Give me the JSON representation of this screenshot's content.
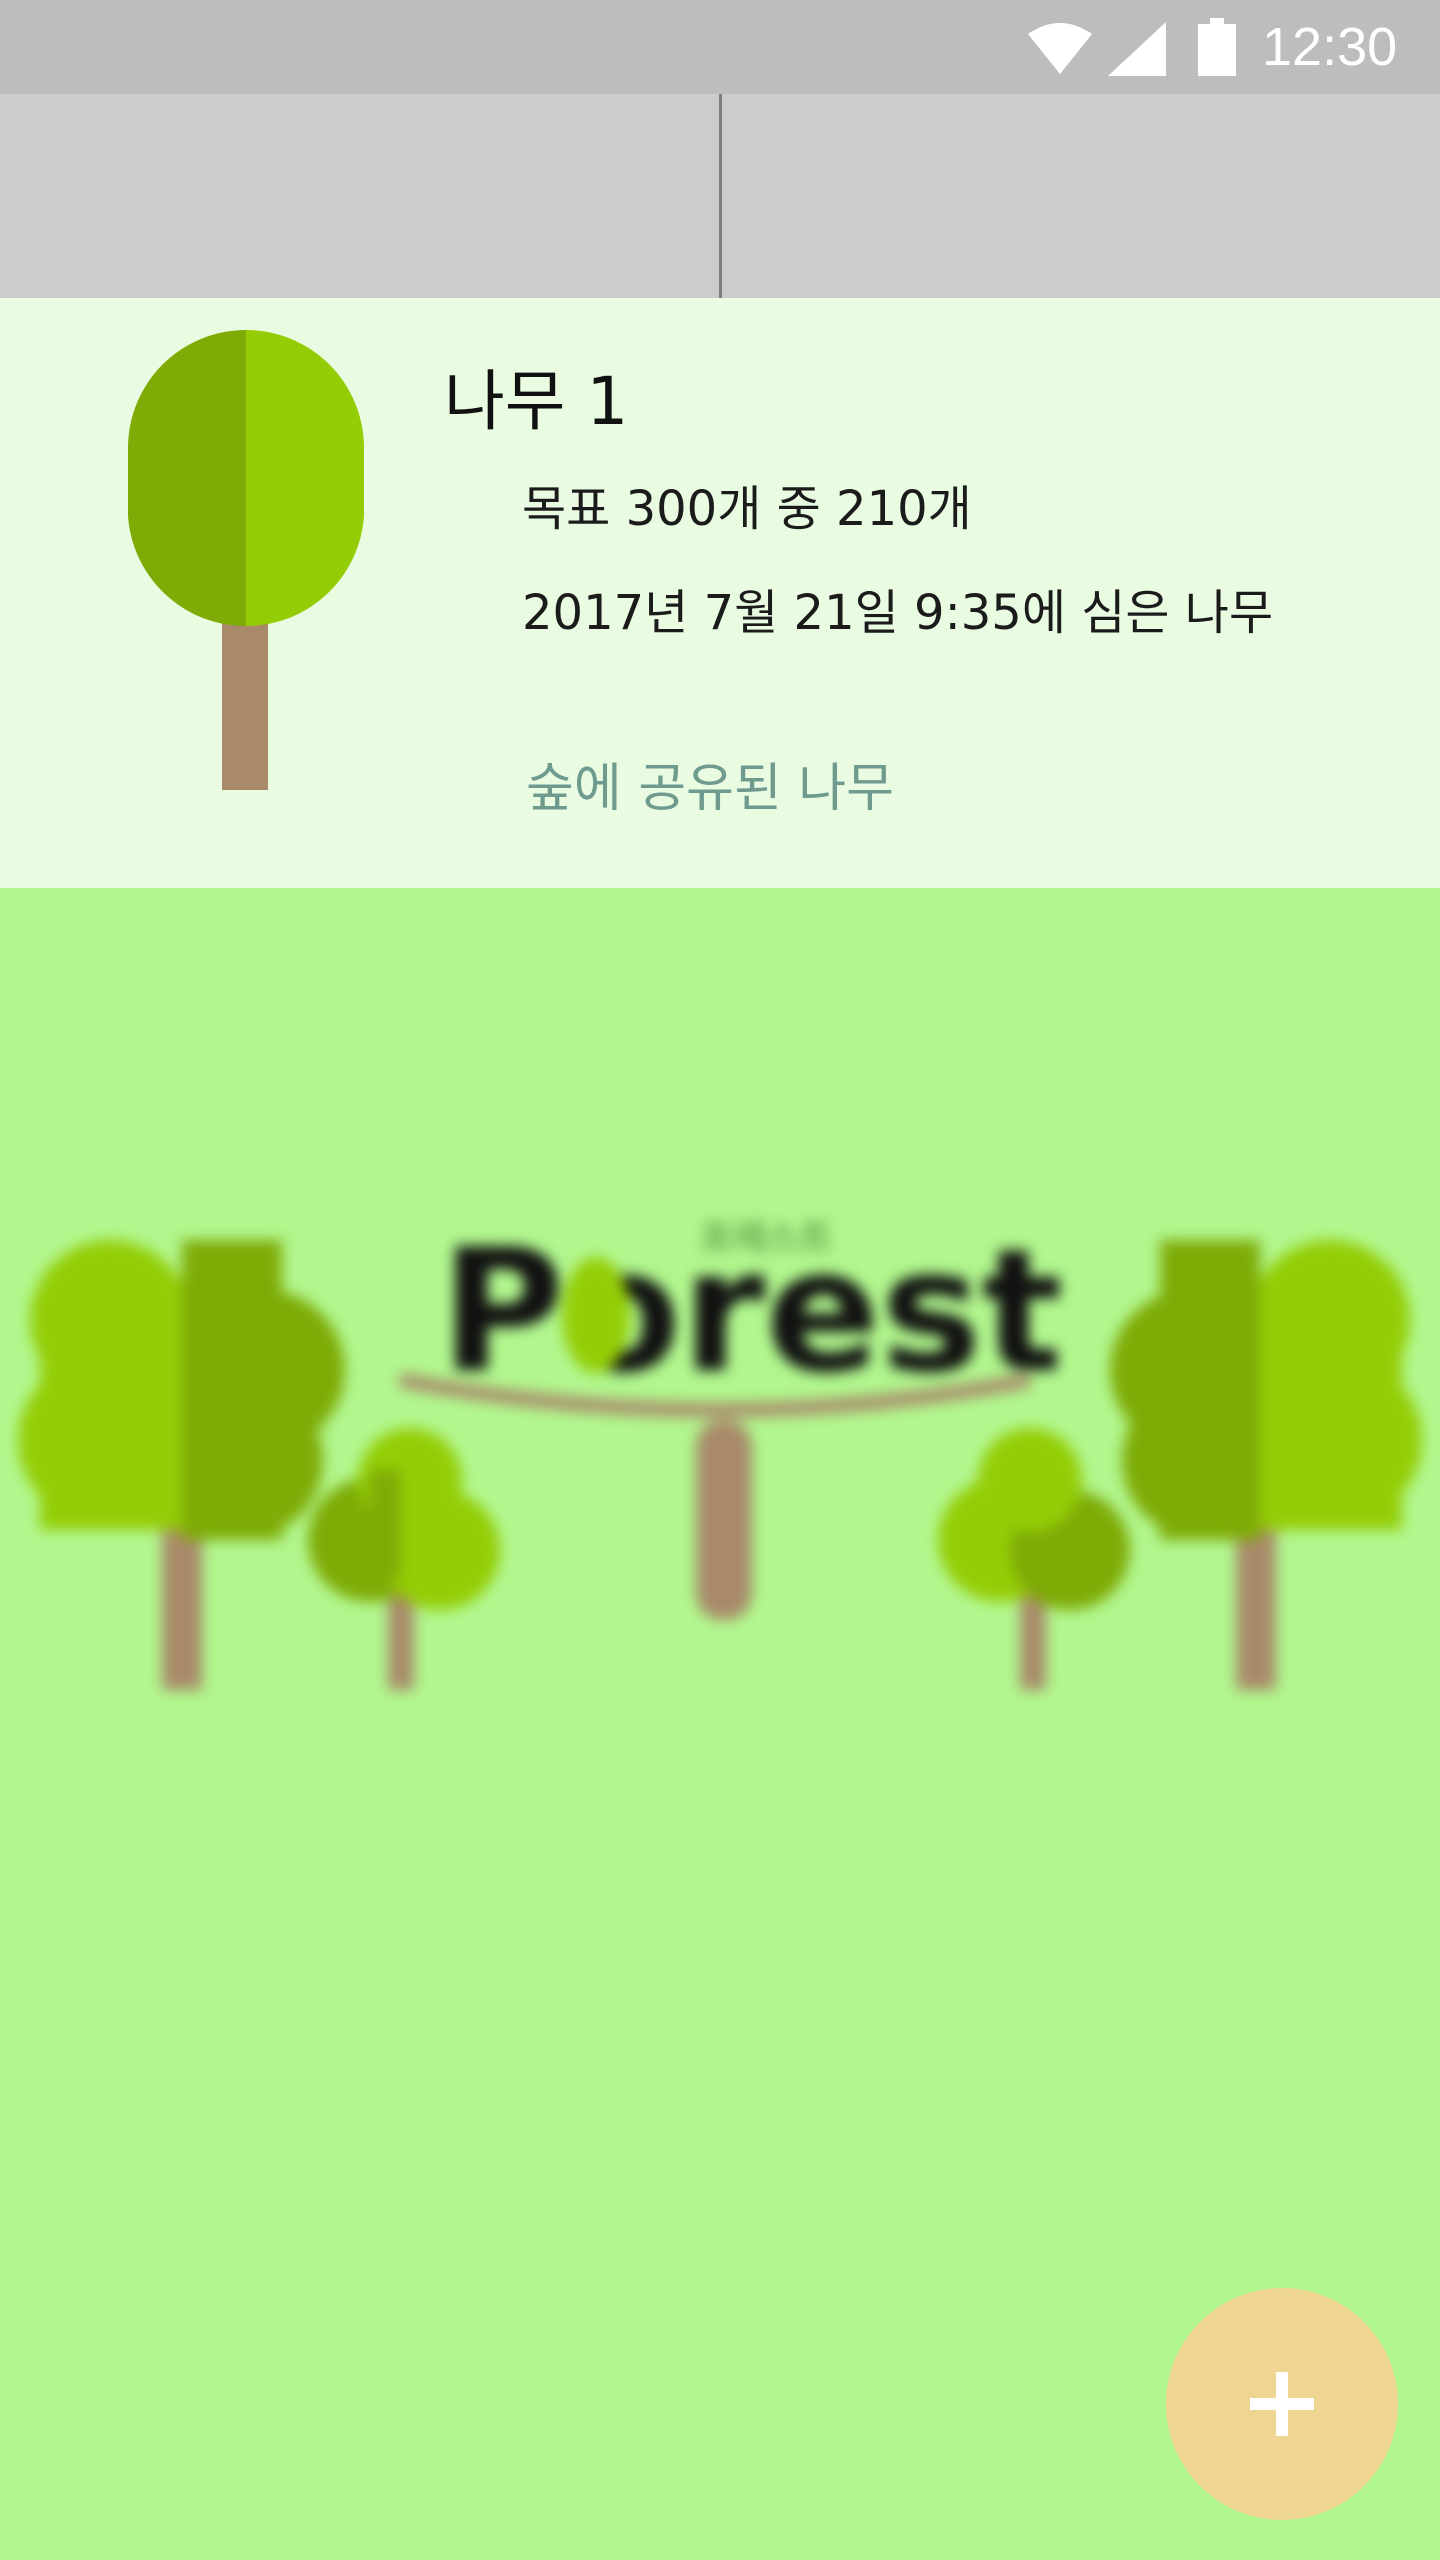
{
  "status_bar": {
    "time": "12:30",
    "icons": [
      "wifi-icon",
      "cell-signal-icon",
      "battery-icon"
    ]
  },
  "tabs": [
    "",
    ""
  ],
  "tree_card": {
    "title": "나무 1",
    "goal_text": "목표 300개 중 210개",
    "planted_text": "2017년 7월 21일 9:35에 심은 나무",
    "shared_label": "숲에 공유된 나무",
    "icon": "tree-icon"
  },
  "forest_logo": {
    "text": "Porest",
    "subtitle": "포레스트"
  },
  "fab": {
    "icon": "plus-icon"
  },
  "colors": {
    "status_bar": "#bdbdbd",
    "tab_bar": "#cccccc",
    "card_bg": "#e9fce2",
    "page_bg": "#b2f78e",
    "shared_label": "#6f9a8e",
    "fab": "#efd592",
    "leaf_dark": "#7eab06",
    "leaf_light": "#94cd06",
    "trunk": "#a88a6a"
  }
}
